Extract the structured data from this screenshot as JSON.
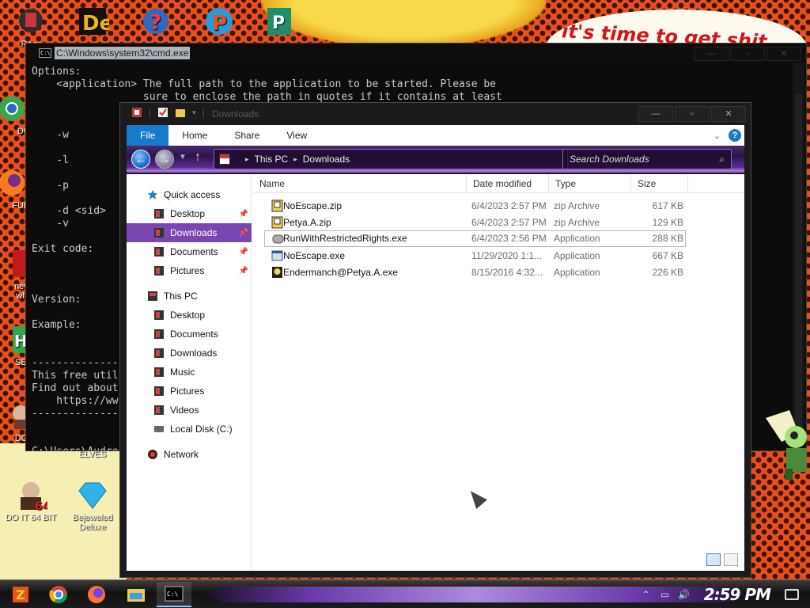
{
  "wallpaper": {
    "bubble_text": "it's time to get shit"
  },
  "desktop_icons": [
    {
      "label": "Recy",
      "icon": "recycle-bin-icon"
    },
    {
      "label": "DO",
      "icon": "chrome-icon"
    },
    {
      "label": "FURF",
      "icon": "firefox-icon"
    },
    {
      "label": "neve why",
      "icon": "app-icon"
    },
    {
      "label": "SEX",
      "icon": "app-icon"
    },
    {
      "label": "DO I",
      "icon": "app-icon"
    },
    {
      "label": "ELVES",
      "icon": "app-icon"
    },
    {
      "label": "DO IT 64 BIT",
      "icon": "portrait-icon"
    },
    {
      "label": "Bejeweled Deluxe",
      "icon": "gem-icon"
    }
  ],
  "cmd": {
    "title": "C:\\Windows\\system32\\cmd.exe",
    "lines": [
      "Options:",
      "    <application> The full path to the application to be started. Please be",
      "                  sure to enclose the path in quotes if it contains at least",
      "",
      "",
      "    -w",
      "",
      "    -l",
      "",
      "    -p",
      "",
      "    -d <sid>",
      "    -v",
      "",
      "Exit code:",
      "",
      "",
      "",
      "Version:",
      "",
      "Example:",
      "",
      "",
      "----------------",
      "This free util",
      "Find out about",
      "    https://ww",
      "----------------",
      "",
      "",
      "C:\\Users\\Audre"
    ]
  },
  "explorer": {
    "title": "Downloads",
    "ribbon_tabs": [
      "File",
      "Home",
      "Share",
      "View"
    ],
    "breadcrumb": [
      "This PC",
      "Downloads"
    ],
    "search_placeholder": "Search Downloads",
    "nav": {
      "quick_access": "Quick access",
      "quick_items": [
        "Desktop",
        "Downloads",
        "Documents",
        "Pictures"
      ],
      "this_pc": "This PC",
      "pc_items": [
        "Desktop",
        "Documents",
        "Downloads",
        "Music",
        "Pictures",
        "Videos",
        "Local Disk (C:)"
      ],
      "network": "Network"
    },
    "columns": [
      "Name",
      "Date modified",
      "Type",
      "Size"
    ],
    "files": [
      {
        "name": "NoEscape.zip",
        "date": "6/4/2023 2:57 PM",
        "type": "zip Archive",
        "size": "617 KB",
        "icon": "zip-icon"
      },
      {
        "name": "Petya.A.zip",
        "date": "6/4/2023 2:57 PM",
        "type": "zip Archive",
        "size": "129 KB",
        "icon": "zip-icon"
      },
      {
        "name": "RunWithRestrictedRights.exe",
        "date": "6/4/2023 2:56 PM",
        "type": "Application",
        "size": "288 KB",
        "icon": "shield-app-icon"
      },
      {
        "name": "NoEscape.exe",
        "date": "11/29/2020 1:1...",
        "type": "Application",
        "size": "667 KB",
        "icon": "app-window-icon"
      },
      {
        "name": "Endermanch@Petya.A.exe",
        "date": "8/15/2016 4:32...",
        "type": "Application",
        "size": "226 KB",
        "icon": "skull-app-icon"
      }
    ]
  },
  "taskbar": {
    "clock": "2:59 PM",
    "apps": [
      "start-icon",
      "chrome-icon",
      "firefox-icon",
      "file-explorer-icon",
      "cmd-icon"
    ]
  },
  "colors": {
    "accent_purple": "#7a46b1",
    "file_tab_blue": "#1979ca"
  }
}
